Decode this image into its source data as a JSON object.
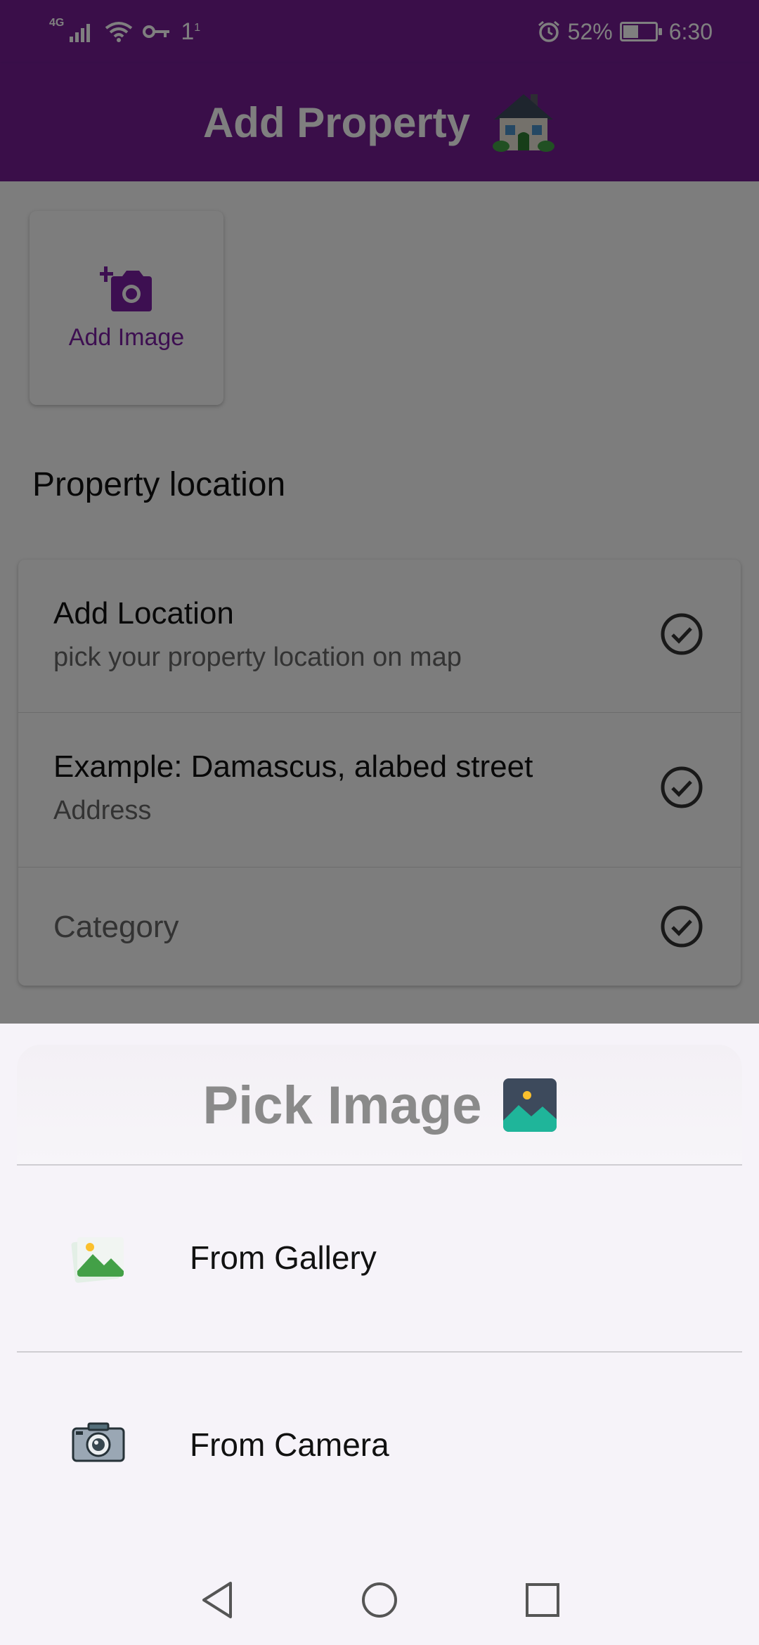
{
  "status_bar": {
    "network_type": "4G",
    "sim_label": "1",
    "sim_sup": "1",
    "battery_percent": "52%",
    "battery_level": 0.52,
    "time": "6:30",
    "icons": [
      "signal-icon",
      "wifi-icon",
      "key-icon",
      "alarm-icon",
      "battery-icon"
    ]
  },
  "app_bar": {
    "title": "Add Property",
    "title_icon": "house-emoji-icon",
    "background": "#741d93"
  },
  "add_image": {
    "label": "Add Image",
    "icon": "add-photo-icon"
  },
  "location": {
    "section_title": "Property location",
    "rows": [
      {
        "title": "Add Location",
        "subtitle": "pick your property location on map",
        "icon": "check-circle-icon"
      },
      {
        "title": "Example: Damascus, alabed street",
        "subtitle": "Address",
        "icon": "check-circle-icon"
      },
      {
        "title": "Category",
        "icon": "check-circle-icon"
      }
    ]
  },
  "sheet": {
    "title": "Pick Image",
    "title_icon": "landscape-picture-icon",
    "options": [
      {
        "label": "From Gallery",
        "icon": "gallery-icon"
      },
      {
        "label": "From Camera",
        "icon": "camera-icon"
      }
    ]
  },
  "nav_bar": {
    "buttons": [
      "back-icon",
      "home-icon",
      "recents-icon"
    ]
  }
}
